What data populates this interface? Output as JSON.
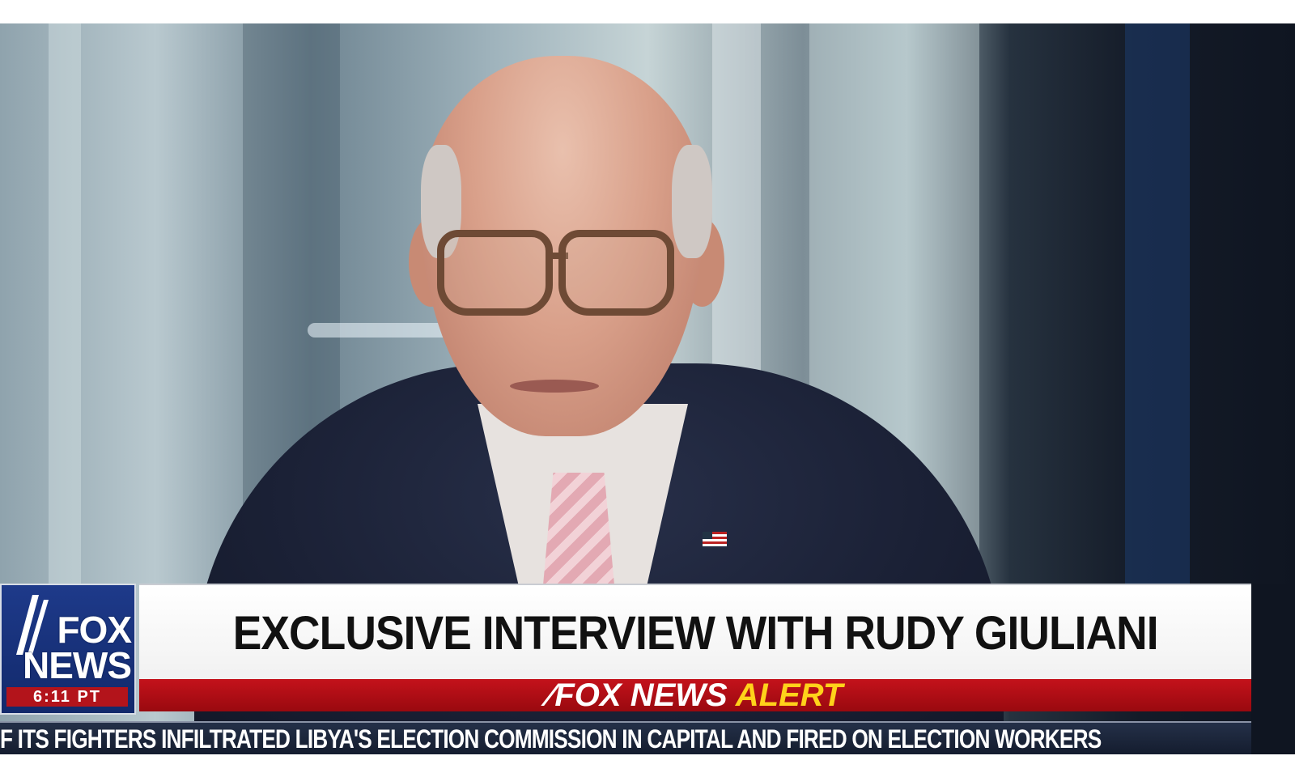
{
  "broadcast": {
    "logo": {
      "line1": "FOX",
      "line2": "NEWS",
      "time": "6:11 PT"
    },
    "headline": "EXCLUSIVE INTERVIEW WITH RUDY GIULIANI",
    "alert": {
      "brand": "FOX NEWS",
      "word": "ALERT"
    },
    "ticker": "F ITS FIGHTERS INFILTRATED LIBYA'S ELECTION COMMISSION IN CAPITAL AND FIRED ON ELECTION WORKERS"
  },
  "colors": {
    "logo_blue": "#1e3a8a",
    "alert_red": "#c4121b",
    "alert_yellow": "#ffd21a",
    "ticker_navy": "#1b2438"
  },
  "icons": [
    "fox-news-slash-icon",
    "flag-pin-icon"
  ]
}
